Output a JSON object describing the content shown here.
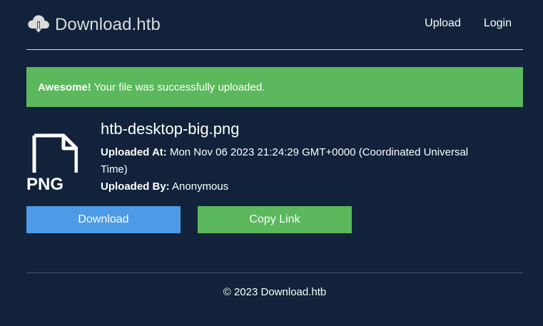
{
  "brand": {
    "name": "Download.htb",
    "icon": "cloud-download-icon"
  },
  "nav": {
    "upload": "Upload",
    "login": "Login"
  },
  "alert": {
    "strong": "Awesome!",
    "message": "Your file was successfully uploaded."
  },
  "file": {
    "icon": "png-file-icon",
    "icon_text": "PNG",
    "name": "htb-desktop-big.png",
    "uploaded_at_label": "Uploaded At:",
    "uploaded_at_value": "Mon Nov 06 2023 21:24:29 GMT+0000 (Coordinated Universal Time)",
    "uploaded_by_label": "Uploaded By:",
    "uploaded_by_value": "Anonymous"
  },
  "actions": {
    "download": "Download",
    "copy_link": "Copy Link"
  },
  "footer": {
    "text": "© 2023 Download.htb"
  },
  "colors": {
    "background": "#11223a",
    "success": "#5cb85c",
    "primary": "#4d9be6"
  }
}
